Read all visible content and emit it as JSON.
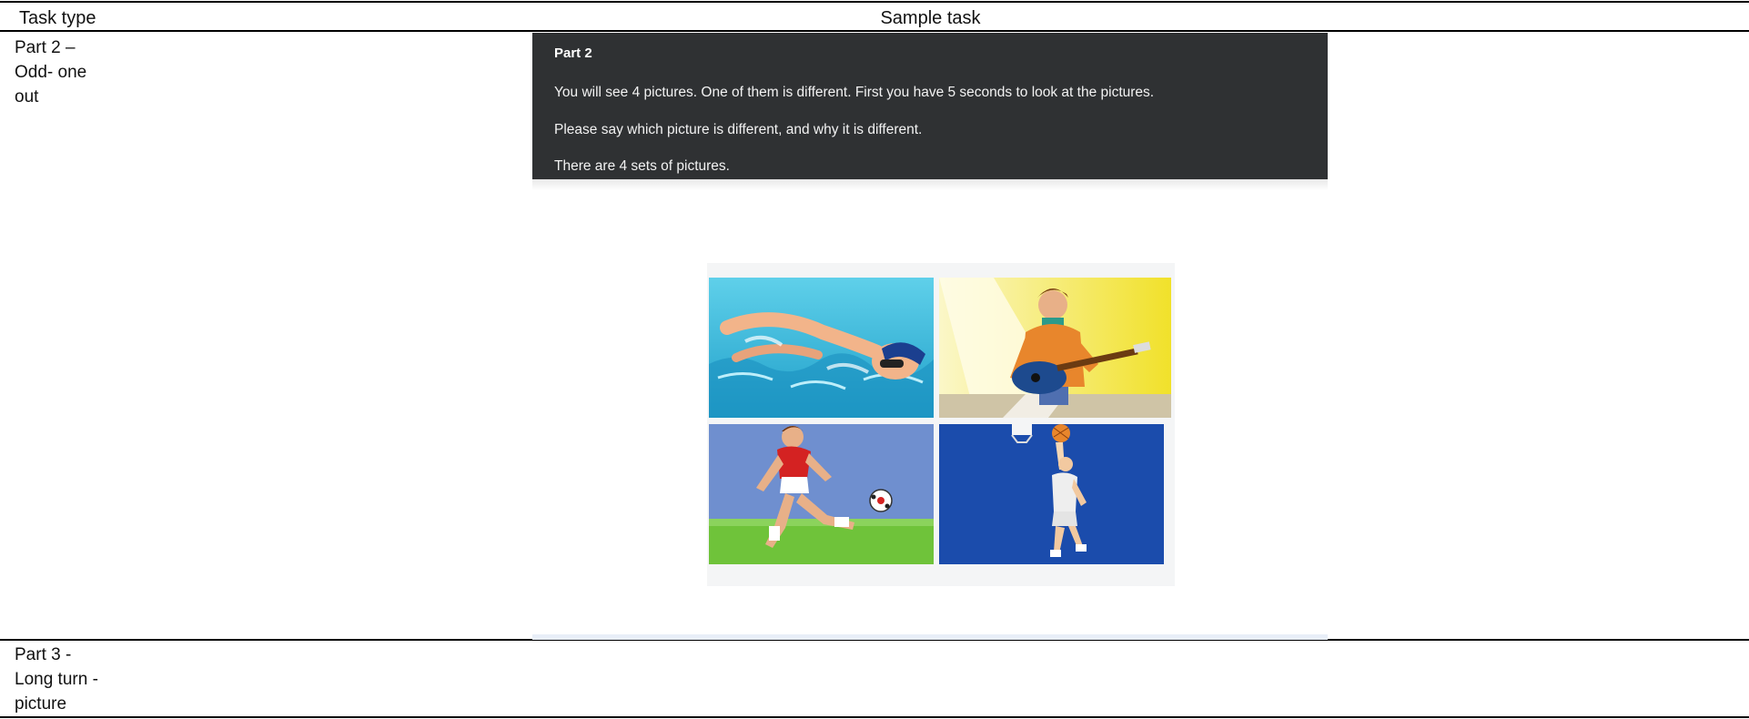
{
  "table": {
    "header": {
      "task_type": "Task type",
      "sample_task": "Sample task"
    },
    "rows": [
      {
        "task_type_lines": [
          "Part 2 –",
          "Odd- one",
          "out"
        ]
      },
      {
        "task_type_lines": [
          "Part 3 -",
          "Long turn -",
          "picture"
        ]
      }
    ]
  },
  "sample": {
    "panel": {
      "title": "Part 2",
      "lines": [
        "You will see 4 pictures. One of them is different. First you have 5 seconds to look at the pictures.",
        "Please say which picture is different, and why it is different.",
        "There are 4 sets of pictures."
      ]
    },
    "pictures": [
      {
        "name": "swimmer",
        "icon": "swimmer-illustration"
      },
      {
        "name": "guitarist",
        "icon": "guitarist-illustration"
      },
      {
        "name": "football-player",
        "icon": "football-player-illustration"
      },
      {
        "name": "basketball-player",
        "icon": "basketball-player-illustration"
      }
    ],
    "colors": {
      "panel_bg": "#2f3133",
      "pool": "#35b7d6",
      "stage": "#f3e534",
      "field_sky": "#6f8fcf",
      "grass": "#6fc33a",
      "court": "#1747a6"
    }
  }
}
